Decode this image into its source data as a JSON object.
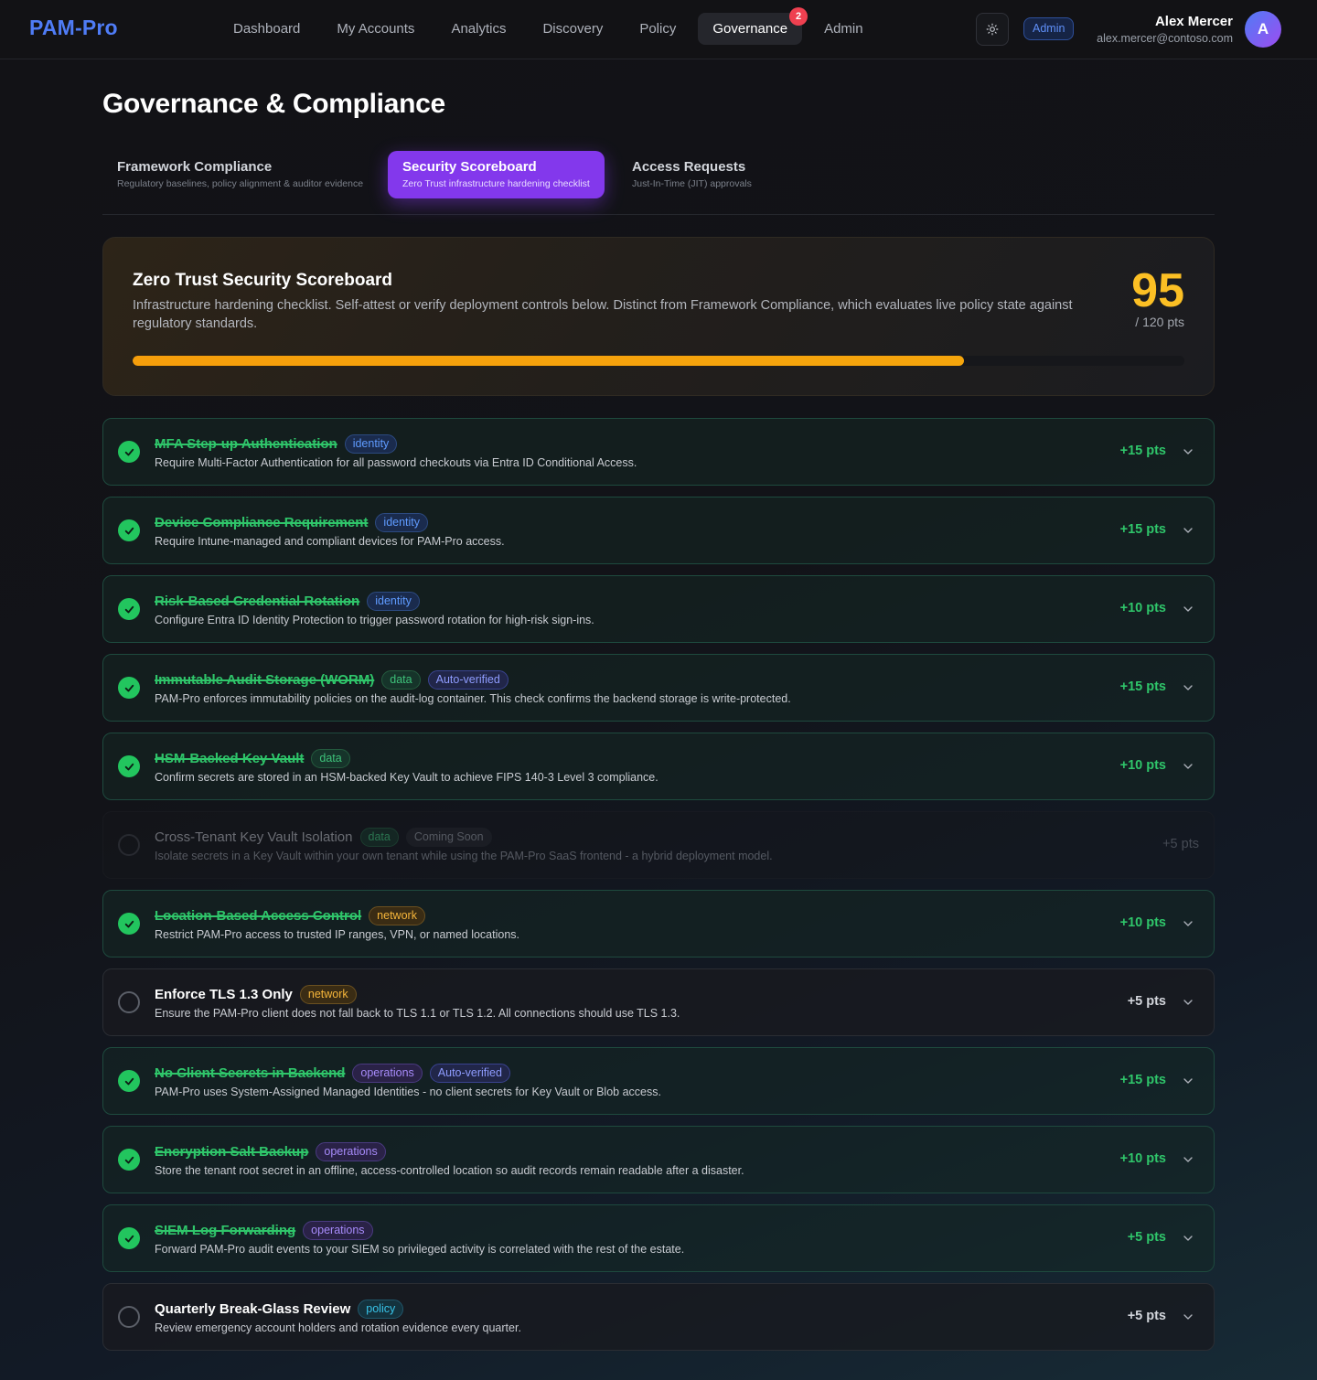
{
  "app": {
    "brand": "PAM-Pro",
    "nav": [
      {
        "label": "Dashboard"
      },
      {
        "label": "My Accounts"
      },
      {
        "label": "Analytics"
      },
      {
        "label": "Discovery"
      },
      {
        "label": "Policy"
      },
      {
        "label": "Governance",
        "active": true,
        "badge": "2"
      },
      {
        "label": "Admin"
      }
    ],
    "theme_icon": "sun-icon",
    "role_badge": "Admin",
    "user": {
      "name": "Alex Mercer",
      "email": "alex.mercer@contoso.com",
      "initial": "A"
    }
  },
  "page": {
    "title": "Governance & Compliance",
    "tabs": [
      {
        "label": "Framework Compliance",
        "sub": "Regulatory baselines, policy alignment & auditor evidence"
      },
      {
        "label": "Security Scoreboard",
        "sub": "Zero Trust infrastructure hardening checklist",
        "active": true
      },
      {
        "label": "Access Requests",
        "sub": "Just-In-Time (JIT) approvals"
      }
    ]
  },
  "scoreboard": {
    "title": "Zero Trust Security Scoreboard",
    "description": "Infrastructure hardening checklist. Self-attest or verify deployment controls below. Distinct from Framework Compliance, which evaluates live policy state against regulatory standards.",
    "score": "95",
    "max_label": "/ 120 pts",
    "progress_fraction": 0.79,
    "accent_color": "#fbbf24"
  },
  "items": [
    {
      "title": "MFA Step-up Authentication",
      "tags": [
        {
          "text": "identity",
          "kind": "identity"
        }
      ],
      "desc": "Require Multi-Factor Authentication for all password checkouts via Entra ID Conditional Access.",
      "points": "+15 pts",
      "status": "done"
    },
    {
      "title": "Device Compliance Requirement",
      "tags": [
        {
          "text": "identity",
          "kind": "identity"
        }
      ],
      "desc": "Require Intune-managed and compliant devices for PAM-Pro access.",
      "points": "+15 pts",
      "status": "done"
    },
    {
      "title": "Risk-Based Credential Rotation",
      "tags": [
        {
          "text": "identity",
          "kind": "identity"
        }
      ],
      "desc": "Configure Entra ID Identity Protection to trigger password rotation for high-risk sign-ins.",
      "points": "+10 pts",
      "status": "done"
    },
    {
      "title": "Immutable Audit Storage (WORM)",
      "tags": [
        {
          "text": "data",
          "kind": "data"
        },
        {
          "text": "Auto-verified",
          "kind": "auto"
        }
      ],
      "desc": "PAM-Pro enforces immutability policies on the audit-log container. This check confirms the backend storage is write-protected.",
      "points": "+15 pts",
      "status": "done"
    },
    {
      "title": "HSM-Backed Key Vault",
      "tags": [
        {
          "text": "data",
          "kind": "data"
        }
      ],
      "desc": "Confirm secrets are stored in an HSM-backed Key Vault to achieve FIPS 140-3 Level 3 compliance.",
      "points": "+10 pts",
      "status": "done"
    },
    {
      "title": "Cross-Tenant Key Vault Isolation",
      "tags": [
        {
          "text": "data",
          "kind": "data"
        },
        {
          "text": "Coming Soon",
          "kind": "soon"
        }
      ],
      "desc": "Isolate secrets in a Key Vault within your own tenant while using the PAM-Pro SaaS frontend - a hybrid deployment model.",
      "points": "+5 pts",
      "status": "disabled"
    },
    {
      "title": "Location-Based Access Control",
      "tags": [
        {
          "text": "network",
          "kind": "network"
        }
      ],
      "desc": "Restrict PAM-Pro access to trusted IP ranges, VPN, or named locations.",
      "points": "+10 pts",
      "status": "done"
    },
    {
      "title": "Enforce TLS 1.3 Only",
      "tags": [
        {
          "text": "network",
          "kind": "network"
        }
      ],
      "desc": "Ensure the PAM-Pro client does not fall back to TLS 1.1 or TLS 1.2. All connections should use TLS 1.3.",
      "points": "+5 pts",
      "status": "pending"
    },
    {
      "title": "No Client Secrets in Backend",
      "tags": [
        {
          "text": "operations",
          "kind": "operations"
        },
        {
          "text": "Auto-verified",
          "kind": "auto"
        }
      ],
      "desc": "PAM-Pro uses System-Assigned Managed Identities - no client secrets for Key Vault or Blob access.",
      "points": "+15 pts",
      "status": "done"
    },
    {
      "title": "Encryption Salt Backup",
      "tags": [
        {
          "text": "operations",
          "kind": "operations"
        }
      ],
      "desc": "Store the tenant root secret in an offline, access-controlled location so audit records remain readable after a disaster.",
      "points": "+10 pts",
      "status": "done"
    },
    {
      "title": "SIEM Log Forwarding",
      "tags": [
        {
          "text": "operations",
          "kind": "operations"
        }
      ],
      "desc": "Forward PAM-Pro audit events to your SIEM so privileged activity is correlated with the rest of the estate.",
      "points": "+5 pts",
      "status": "done"
    },
    {
      "title": "Quarterly Break-Glass Review",
      "tags": [
        {
          "text": "policy",
          "kind": "policy"
        }
      ],
      "desc": "Review emergency account holders and rotation evidence every quarter.",
      "points": "+5 pts",
      "status": "pending"
    }
  ]
}
